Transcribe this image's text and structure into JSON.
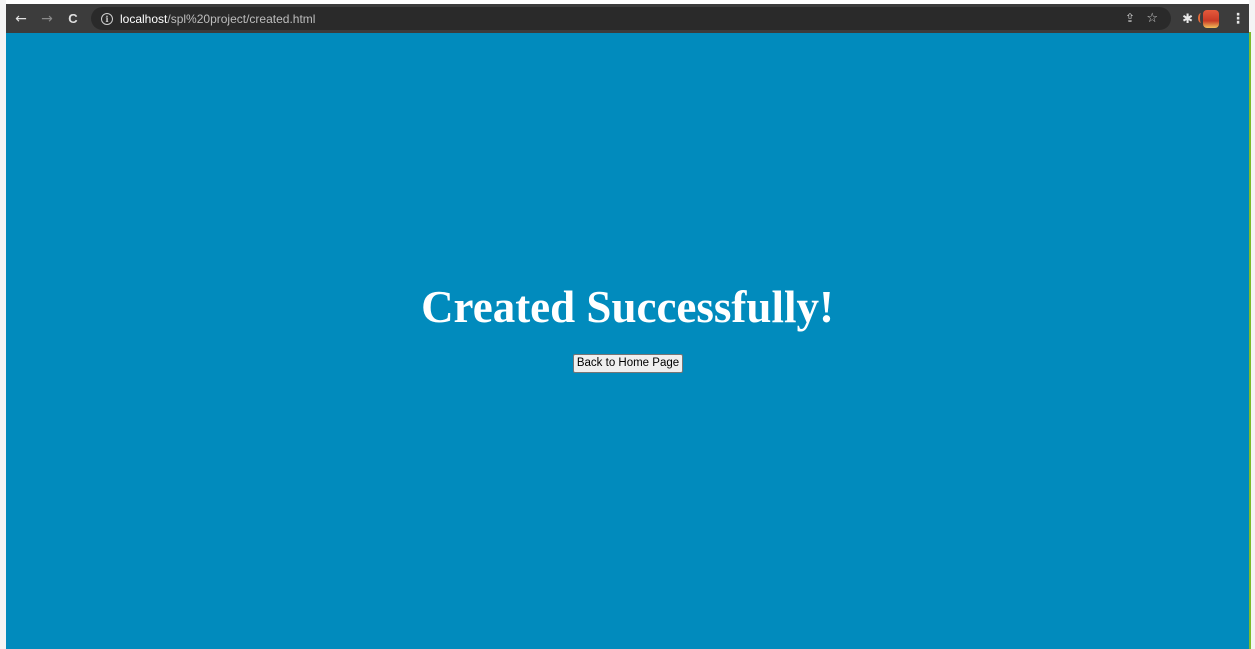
{
  "browser": {
    "back_glyph": "←",
    "forward_glyph": "→",
    "reload_glyph": "C",
    "info_glyph": "i",
    "url_host": "localhost",
    "url_path": "/spl%20project/created.html",
    "share_glyph": "⇪",
    "star_glyph": "☆",
    "extensions_glyph": "✱",
    "menu_glyph": "⋮",
    "icons": {
      "back": "back-arrow-icon",
      "forward": "forward-arrow-icon",
      "reload": "reload-icon",
      "site_info": "info-icon",
      "share": "share-icon",
      "bookmark": "star-icon",
      "extensions": "puzzle-icon",
      "profile": "avatar",
      "menu": "kebab-menu-icon"
    }
  },
  "page": {
    "heading": "Created Successfully!",
    "home_button_label": "Back to Home Page",
    "background_color": "#018bbd",
    "text_color": "#ffffff"
  }
}
